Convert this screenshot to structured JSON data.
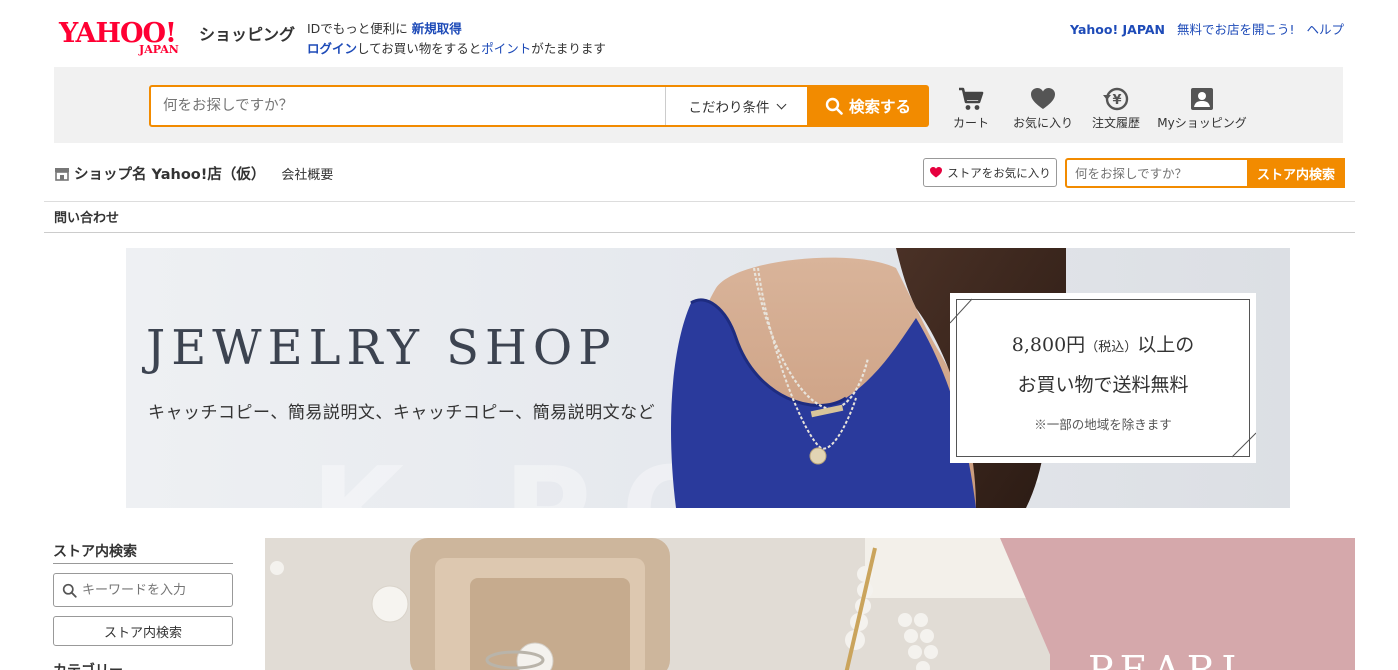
{
  "header": {
    "logo_text": "YAHOO!",
    "logo_sub": "JAPAN",
    "shopping_label": "ショッピング",
    "promo_line1_prefix": "IDでもっと便利に",
    "promo_line1_link": "新規取得",
    "promo_line2_login": "ログイン",
    "promo_line2_mid": "してお買い物をすると",
    "promo_line2_point": "ポイント",
    "promo_line2_suffix": "がたまります",
    "top_links": [
      "Yahoo! JAPAN",
      "無料でお店を開こう!",
      "ヘルプ"
    ]
  },
  "search": {
    "placeholder": "何をお探しですか？",
    "condition_label": "こだわり条件",
    "button_label": "検索する"
  },
  "nav_icons": [
    {
      "label": "カート",
      "icon": "cart-icon"
    },
    {
      "label": "お気に入り",
      "icon": "heart-icon"
    },
    {
      "label": "注文履歴",
      "icon": "order-history-icon"
    },
    {
      "label": "Myショッピング",
      "icon": "my-shopping-icon"
    }
  ],
  "shop": {
    "name": "ショップ名 Yahoo!店（仮）",
    "overview_link": "会社概要",
    "favorite_button": "ストアをお気に入り",
    "store_search_placeholder": "何をお探しですか？",
    "store_search_button": "ストア内検索",
    "inquiry_link": "問い合わせ"
  },
  "hero": {
    "title": "JEWELRY SHOP",
    "copy": "キャッチコピー、簡易説明文、キャッチコピー、簡易説明文など",
    "box_price": "8,800円",
    "box_tax": "（税込）",
    "box_price_suffix": "以上の",
    "box_line2": "お買い物で送料無料",
    "box_note": "※一部の地域を除きます",
    "watermark": "K-POINT"
  },
  "sidebar": {
    "title": "ストア内検索",
    "keyword_placeholder": "キーワードを入力",
    "search_button": "ストア内検索",
    "next_heading": "カテゴリー"
  },
  "banner2": {
    "title": "PEARL"
  },
  "colors": {
    "accent_orange": "#f28b00",
    "link_blue": "#1e4bb8",
    "yahoo_red": "#ff0033",
    "pearl_pink": "#d5a8ab"
  }
}
